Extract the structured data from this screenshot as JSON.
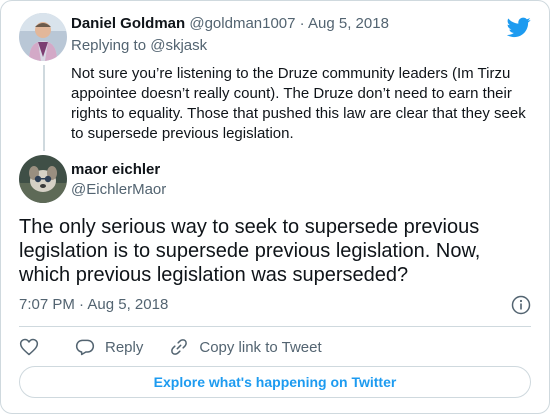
{
  "parent_tweet": {
    "author_name": "Daniel Goldman",
    "author_handle": "@goldman1007",
    "separator": "·",
    "date": "Aug 5, 2018",
    "replying_prefix": "Replying to ",
    "replying_handle": "@skjask",
    "text": "Not sure you’re listening to the Druze community leaders (Im Tirzu appointee doesn’t really count). The Druze don’t need to earn their rights to equality. Those that pushed this law are clear that they seek to supersede previous legislation."
  },
  "main_tweet": {
    "author_name": "maor eichler",
    "author_handle": "@EichlerMaor",
    "text": "The only serious way to seek to supersede previous legislation is to supersede previous legislation. Now, which previous legislation was superseded?",
    "time": "7:07 PM",
    "separator": "·",
    "date": "Aug 5, 2018"
  },
  "actions": {
    "reply_label": "Reply",
    "copy_link_label": "Copy link to Tweet"
  },
  "explore_label": "Explore what's happening on Twitter",
  "icons": {
    "brand": "twitter-bird-icon",
    "info": "info-icon",
    "like": "heart-icon",
    "reply": "speech-bubble-icon",
    "copy": "link-icon"
  },
  "colors": {
    "accent": "#1d9bf0",
    "muted_text": "#536471",
    "border": "#cfd9de"
  }
}
